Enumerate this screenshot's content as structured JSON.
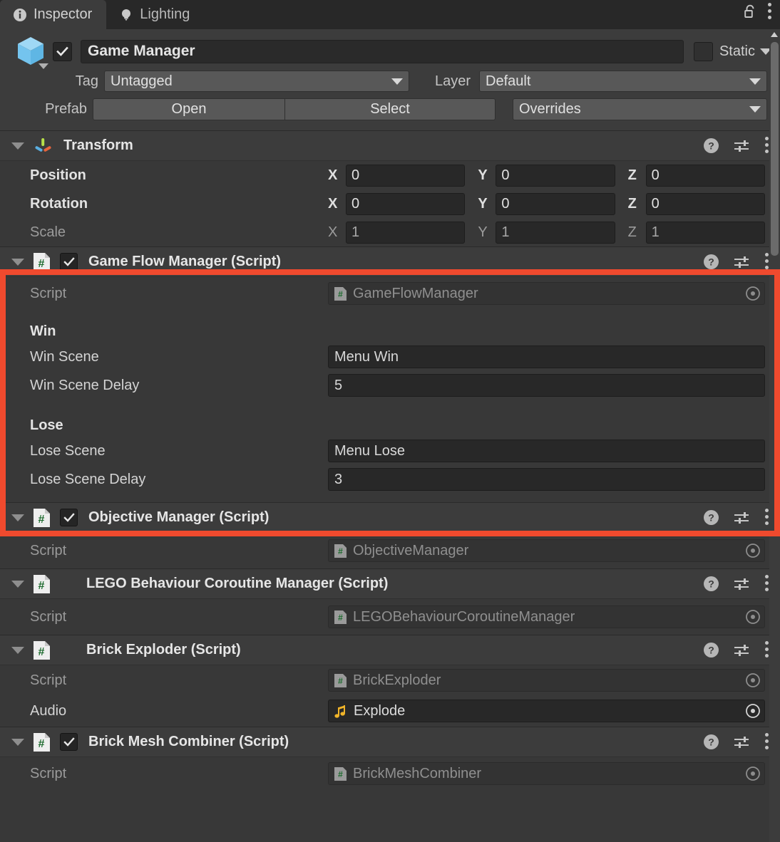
{
  "window": {
    "tabs": [
      {
        "label": "Inspector",
        "icon": "info-icon",
        "active": true
      },
      {
        "label": "Lighting",
        "icon": "lightbulb-icon",
        "active": false
      }
    ],
    "lock_icon": "unlocked-padlock-icon",
    "menu_icon": "kebab-menu-icon"
  },
  "gameobject": {
    "icon": "cube-icon",
    "enabled": true,
    "name": "Game Manager",
    "static_label": "Static",
    "tag_label": "Tag",
    "tag_value": "Untagged",
    "layer_label": "Layer",
    "layer_value": "Default",
    "prefab_label": "Prefab",
    "prefab_open": "Open",
    "prefab_select": "Select",
    "prefab_overrides": "Overrides"
  },
  "transform": {
    "title": "Transform",
    "icon": "transform-axis-icon",
    "rows": [
      {
        "label": "Position",
        "x": "0",
        "y": "0",
        "z": "0",
        "dim": false
      },
      {
        "label": "Rotation",
        "x": "0",
        "y": "0",
        "z": "0",
        "dim": false
      },
      {
        "label": "Scale",
        "x": "1",
        "y": "1",
        "z": "1",
        "dim": true
      }
    ],
    "axis_x": "X",
    "axis_y": "Y",
    "axis_z": "Z"
  },
  "components": {
    "game_flow_manager": {
      "title": "Game Flow Manager (Script)",
      "has_checkbox": true,
      "enabled": true,
      "script_label": "Script",
      "script_value": "GameFlowManager",
      "win_header": "Win",
      "win_scene_label": "Win Scene",
      "win_scene_value": "Menu Win",
      "win_delay_label": "Win Scene Delay",
      "win_delay_value": "5",
      "lose_header": "Lose",
      "lose_scene_label": "Lose Scene",
      "lose_scene_value": "Menu Lose",
      "lose_delay_label": "Lose Scene Delay",
      "lose_delay_value": "3",
      "highlighted": true,
      "highlight_color": "#f04a2e"
    },
    "objective_manager": {
      "title": "Objective Manager (Script)",
      "has_checkbox": true,
      "script_label": "Script",
      "script_value": "ObjectiveManager"
    },
    "lego_behaviour_coroutine_manager": {
      "title": "LEGO Behaviour Coroutine Manager (Script)",
      "has_checkbox": false,
      "script_label": "Script",
      "script_value": "LEGOBehaviourCoroutineManager"
    },
    "brick_exploder": {
      "title": "Brick Exploder (Script)",
      "has_checkbox": false,
      "script_label": "Script",
      "script_value": "BrickExploder",
      "audio_label": "Audio",
      "audio_value": "Explode"
    },
    "brick_mesh_combiner": {
      "title": "Brick Mesh Combiner (Script)",
      "has_checkbox": true,
      "script_label": "Script",
      "script_value": "BrickMeshCombiner"
    }
  },
  "header_icons": {
    "help": "help-icon",
    "preset": "preset-sliders-icon",
    "menu": "kebab-menu-icon"
  }
}
